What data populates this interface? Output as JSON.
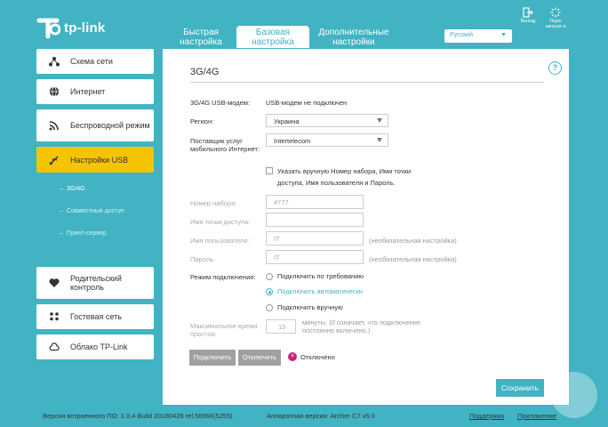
{
  "brand": {
    "name": "tp-link",
    "accent": "#41b3c3",
    "highlight": "#f5c400"
  },
  "header": {
    "tabs": [
      {
        "label": "Быстрая настройка"
      },
      {
        "label": "Базовая настройка"
      },
      {
        "label": "Дополнительные настройки"
      }
    ],
    "language": "Русский",
    "logout_label": "Выход",
    "reboot_label": "Пере загрузк а"
  },
  "sidebar": {
    "items": [
      {
        "label": "Схема сети",
        "icon": "network-map-icon"
      },
      {
        "label": "Интернет",
        "icon": "globe-icon"
      },
      {
        "label": "Беспроводной режим",
        "icon": "wifi-icon"
      },
      {
        "label": "Настройки USB",
        "icon": "usb-icon"
      },
      {
        "label": "Родительский контроль",
        "icon": "heart-icon"
      },
      {
        "label": "Гостевая сеть",
        "icon": "guest-users-icon"
      },
      {
        "label": "Облако TP-Link",
        "icon": "cloud-icon"
      }
    ],
    "usb_subitems": [
      {
        "label": "3G/4G"
      },
      {
        "label": "Совместный доступ"
      },
      {
        "label": "Принт-сервер"
      }
    ]
  },
  "main": {
    "title": "3G/4G",
    "modem_label": "3G/4G USB-модем:",
    "modem_status": "USB-модем не подключен",
    "region_label": "Регион:",
    "region_value": "Украина",
    "provider_label": "Поставщик услуг мобильного Интернет:",
    "provider_value": "Intertelecom",
    "manual_checkbox_label": "Указать вручную Номер набора, Имя точки доступа, Имя пользователя и Пароль.",
    "dial_label": "Номер набора:",
    "dial_value": "#777",
    "apn_label": "Имя точки доступа:",
    "apn_value": "",
    "username_label": "Имя пользователя:",
    "username_value": "IT",
    "username_note": "(необязательная настройка)",
    "password_label": "Пароль:",
    "password_value": "IT",
    "password_note": "(необязательная настройка)",
    "mode_label": "Режим подключения:",
    "mode_options": [
      {
        "label": "Подключить по требованию",
        "selected": false
      },
      {
        "label": "Подключить автоматически",
        "selected": true
      },
      {
        "label": "Подключить вручную",
        "selected": false
      }
    ],
    "idle_label": "Максимальное время простоя:",
    "idle_value": "15",
    "idle_note": "минуты. (0 означает, что подключение постоянно включено.)",
    "connect_button": "Подключить",
    "disconnect_button": "Отключить",
    "connection_status": "Отключено",
    "save_button": "Сохранить"
  },
  "footer": {
    "firmware": "Версия встроенного ПО: 1.0.4 Build 20180428 rel.56966(5255)",
    "hardware": "Аппаратная версия: Archer C7 v5.0",
    "support_link": "Поддержка",
    "app_link": "Приложение"
  }
}
